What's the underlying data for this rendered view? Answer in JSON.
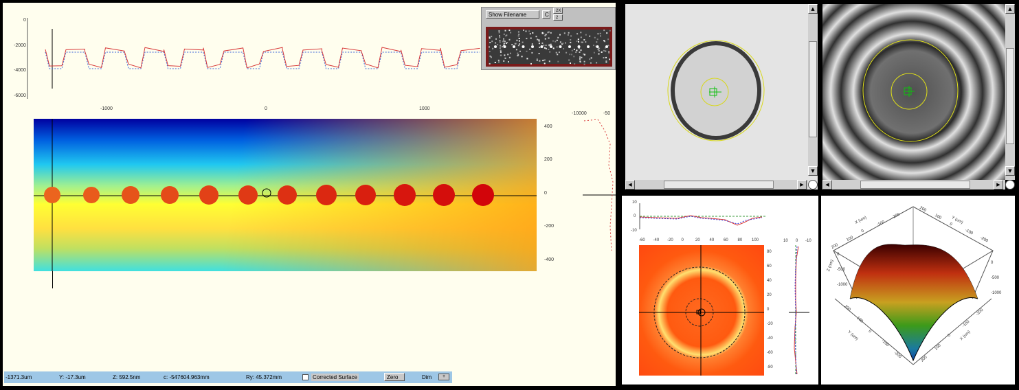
{
  "profile_plot": {
    "y_ticks": [
      "0",
      "-2000",
      "-4000",
      "-6000"
    ],
    "x_ticks": [
      "-1000",
      "0",
      "1000"
    ],
    "series_color": "#d83a3a"
  },
  "viewer_buttons": {
    "show_filename": "Show Filename",
    "c": "C",
    "zoom_up": "2X",
    "zoom_down": "2"
  },
  "colormap": {
    "right_ticks": [
      "400",
      "200",
      "0",
      "-200",
      "-400"
    ],
    "spot_count": 12,
    "gradient_low": "#0000a0",
    "gradient_mid": "#ffff33",
    "gradient_high": "#ff9a10"
  },
  "side_profile": {
    "top_ticks": [
      "-10000",
      "-50"
    ]
  },
  "status_bar": {
    "x": "-1371.3um",
    "y": "Y: -17.3um",
    "z": "Z: 592.5nm",
    "c": "c: -547604.963mm",
    "ry": "Ry: 45.372mm",
    "checkbox_label": "Corrected Surface",
    "zero_button": "Zero",
    "dim_button": "Dim"
  },
  "top_views": {
    "left_panel": "intensity",
    "right_panel": "fringes"
  },
  "lower_left_plot": {
    "top_y_ticks": [
      "10",
      "0",
      "-10"
    ],
    "x_ticks": [
      "-60",
      "-40",
      "-20",
      "0",
      "20",
      "40",
      "60",
      "80",
      "100"
    ],
    "y_ticks": [
      "80",
      "60",
      "40",
      "20",
      "0",
      "-20",
      "-40",
      "-60",
      "-80"
    ],
    "side_top_ticks": [
      "10",
      "0",
      "-10"
    ]
  },
  "surface_3d": {
    "top_axis_left": "X (um)",
    "top_axis_right": "Y (um)",
    "bottom_axis_left": "Y (um)",
    "bottom_axis_right": "X (um)",
    "z_axis": "Z (nm)",
    "tick_labels_top_left": [
      "200",
      "100",
      "0",
      "-100",
      "-200"
    ],
    "tick_labels_top_right": [
      "200",
      "100",
      "0",
      "-100",
      "-200"
    ],
    "tick_labels_bottom_left": [
      "200",
      "100",
      "0",
      "-100",
      "-200"
    ],
    "tick_labels_bottom_right": [
      "200",
      "100",
      "0",
      "-100",
      "-200"
    ],
    "z_ticks_left": [
      "0",
      "-500",
      "-1000"
    ],
    "z_ticks_right": [
      "0",
      "-500",
      "-1000"
    ]
  }
}
